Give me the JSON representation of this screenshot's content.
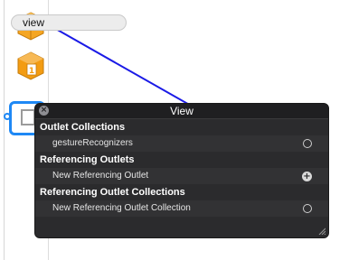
{
  "drag_label": "view",
  "popover": {
    "title": "View",
    "sections": [
      {
        "header": "Outlet Collections",
        "rows": [
          {
            "label": "gestureRecognizers",
            "control": "empty-circle-icon"
          }
        ]
      },
      {
        "header": "Referencing Outlets",
        "rows": [
          {
            "label": "New Referencing Outlet",
            "control": "plus-circle-icon"
          }
        ]
      },
      {
        "header": "Referencing Outlet Collections",
        "rows": [
          {
            "label": "New Referencing Outlet Collection",
            "control": "empty-circle-icon"
          }
        ]
      }
    ]
  },
  "colors": {
    "connection_line": "#1a1ae6",
    "selection_blue": "#1e88f5",
    "hud_background": "#2b2b2d",
    "scene_icon_orange": "#f5a623"
  },
  "icons": {
    "scene": "view-controller-cube-icon",
    "first_responder": "first-responder-cube-icon",
    "view_controller": "view-controller-icon",
    "close": "close-icon",
    "resize": "resize-grip-icon"
  }
}
